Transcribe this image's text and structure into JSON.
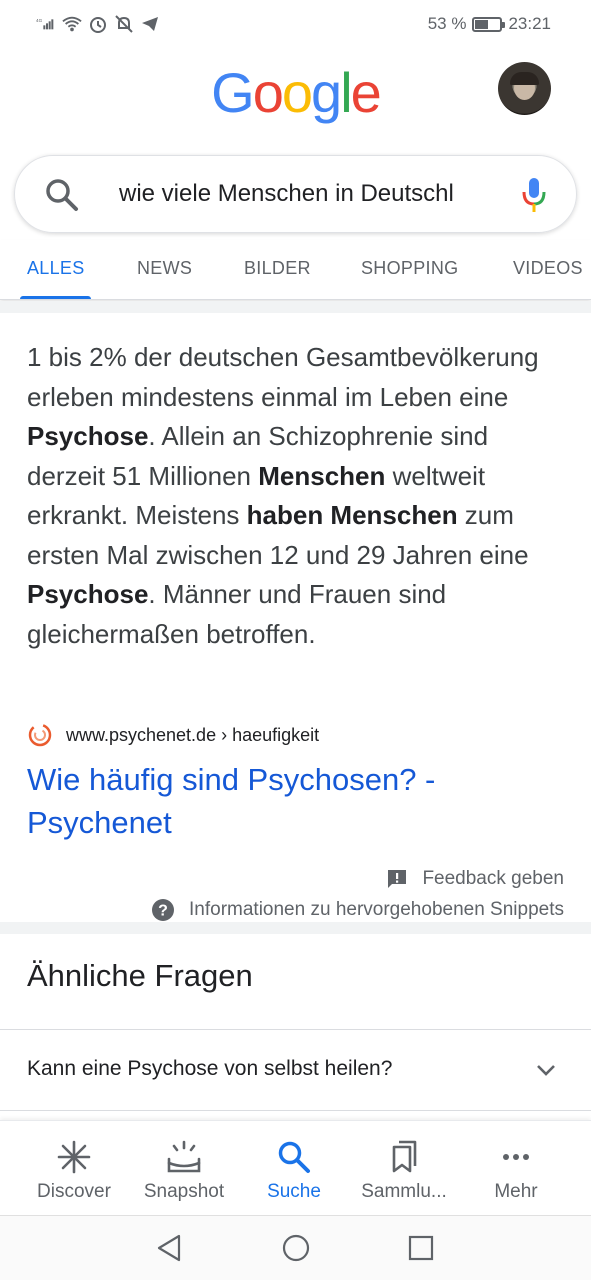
{
  "status_bar": {
    "network": "4G",
    "battery_text": "53 %",
    "battery_level": 0.53,
    "time": "23:21"
  },
  "header": {
    "logo_letters": [
      {
        "ch": "G",
        "color": "#4285F4"
      },
      {
        "ch": "o",
        "color": "#EA4335"
      },
      {
        "ch": "o",
        "color": "#FBBC05"
      },
      {
        "ch": "g",
        "color": "#4285F4"
      },
      {
        "ch": "l",
        "color": "#34A853"
      },
      {
        "ch": "e",
        "color": "#EA4335"
      }
    ],
    "avatar": "user-avatar"
  },
  "search": {
    "query": "wie viele Menschen in Deutschl"
  },
  "tabs": [
    {
      "label": "ALLES",
      "active": true
    },
    {
      "label": "NEWS",
      "active": false
    },
    {
      "label": "BILDER",
      "active": false
    },
    {
      "label": "SHOPPING",
      "active": false
    },
    {
      "label": "VIDEOS",
      "active": false
    }
  ],
  "snippet": {
    "segments": [
      {
        "text": "1 bis 2% der deutschen Gesamtbevölkerung erleben mindestens einmal im Leben eine ",
        "bold": false
      },
      {
        "text": "Psychose",
        "bold": true
      },
      {
        "text": ". Allein an Schizophrenie sind derzeit 51 Millionen ",
        "bold": false
      },
      {
        "text": "Menschen",
        "bold": true
      },
      {
        "text": " weltweit erkrankt. Meistens ",
        "bold": false
      },
      {
        "text": "haben Menschen",
        "bold": true
      },
      {
        "text": " zum ersten Mal zwischen 12 und 29 Jahren eine ",
        "bold": false
      },
      {
        "text": "Psychose",
        "bold": true
      },
      {
        "text": ". Männer und Frauen sind gleichermaßen betroffen.",
        "bold": false
      }
    ],
    "source_domain": "www.psychenet.de",
    "source_path": " › haeufigkeit",
    "link_title": "Wie häufig sind Psychosen? - Psychenet",
    "feedback_label": "Feedback geben",
    "info_label": "Informationen zu hervorgehobenen Snippets"
  },
  "related": {
    "title": "Ähnliche Fragen",
    "questions": [
      "Kann eine Psychose von selbst heilen?"
    ]
  },
  "bottom_nav": [
    {
      "label": "Discover",
      "icon": "asterisk-icon",
      "active": false
    },
    {
      "label": "Snapshot",
      "icon": "snapshot-icon",
      "active": false
    },
    {
      "label": "Suche",
      "icon": "search-icon",
      "active": true
    },
    {
      "label": "Sammlu...",
      "icon": "collections-icon",
      "active": false
    },
    {
      "label": "Mehr",
      "icon": "more-icon",
      "active": false
    }
  ],
  "colors": {
    "accent": "#1a73e8",
    "link": "#1558d6"
  }
}
